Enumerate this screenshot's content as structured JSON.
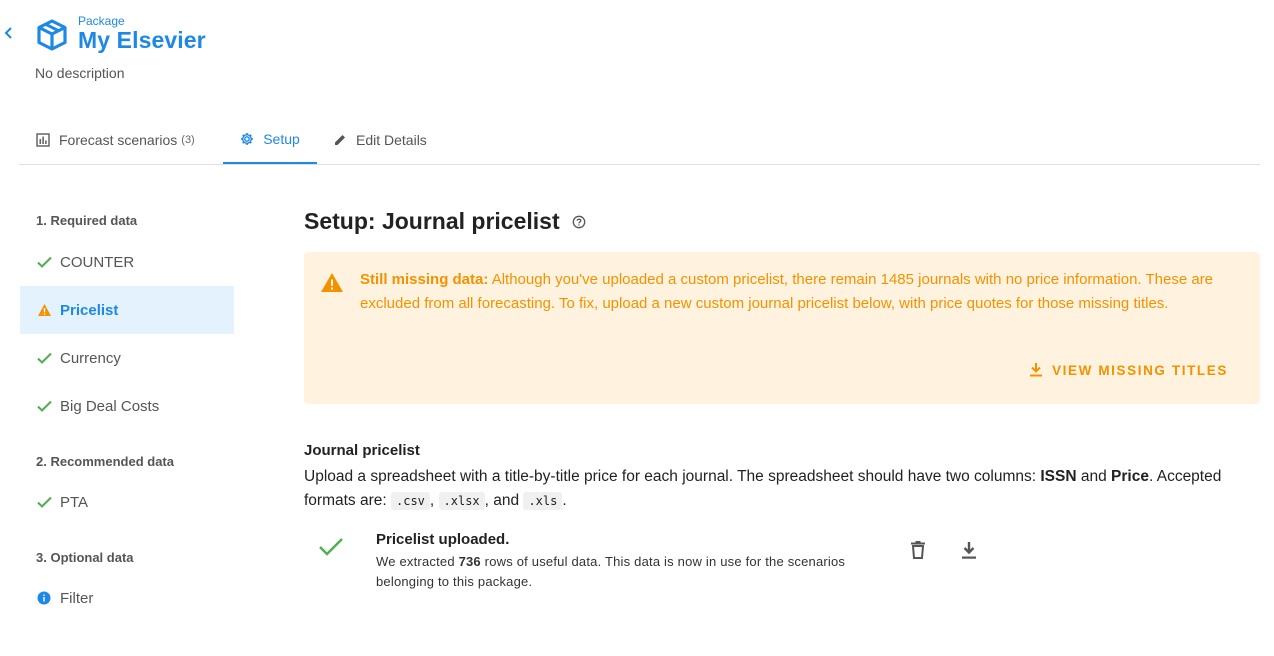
{
  "header": {
    "kicker": "Package",
    "title": "My Elsevier",
    "description": "No description"
  },
  "tabs": [
    {
      "label": "Forecast scenarios",
      "count": "(3)",
      "icon": "bar-chart-icon"
    },
    {
      "label": "Setup",
      "icon": "gear-icon",
      "active": true
    },
    {
      "label": "Edit Details",
      "icon": "pencil-icon"
    }
  ],
  "sidebar": {
    "sections": [
      {
        "title": "1. Required data"
      },
      {
        "title": "2. Recommended data"
      },
      {
        "title": "3. Optional data"
      }
    ],
    "items": [
      {
        "label": "COUNTER",
        "status": "complete"
      },
      {
        "label": "Pricelist",
        "status": "warning",
        "active": true
      },
      {
        "label": "Currency",
        "status": "complete"
      },
      {
        "label": "Big Deal Costs",
        "status": "complete"
      },
      {
        "label": "PTA",
        "status": "complete"
      },
      {
        "label": "Filter",
        "status": "info"
      }
    ]
  },
  "main": {
    "title": "Setup: Journal pricelist",
    "alert": {
      "bold": "Still missing data:",
      "text": " Although you've uploaded a custom pricelist, there remain 1485 journals with no price information. These are excluded from all forecasting. To fix, upload a new custom journal pricelist below, with price quotes for those missing titles.",
      "button": "VIEW MISSING TITLES"
    },
    "section_title": "Journal pricelist",
    "desc": {
      "p1": "Upload a spreadsheet with a title-by-title price for each journal. The spreadsheet should have two columns: ",
      "col1": "ISSN",
      "and": " and ",
      "col2": "Price",
      "p2": ". Accepted formats are: ",
      "fmt1": ".csv",
      "sep1": ", ",
      "fmt2": ".xlsx",
      "sep2": ", and ",
      "fmt3": ".xls",
      "end": "."
    },
    "upload": {
      "title": "Pricelist uploaded.",
      "pre": "We extracted ",
      "rows": "736",
      "post": " rows of useful data. This data is now in use for the scenarios belonging to this package."
    }
  },
  "colors": {
    "accent": "#1e88e5",
    "success": "#4caf50",
    "warning": "#f39200",
    "alert_bg": "#fff3e0",
    "active_bg": "#e3f2fd"
  }
}
